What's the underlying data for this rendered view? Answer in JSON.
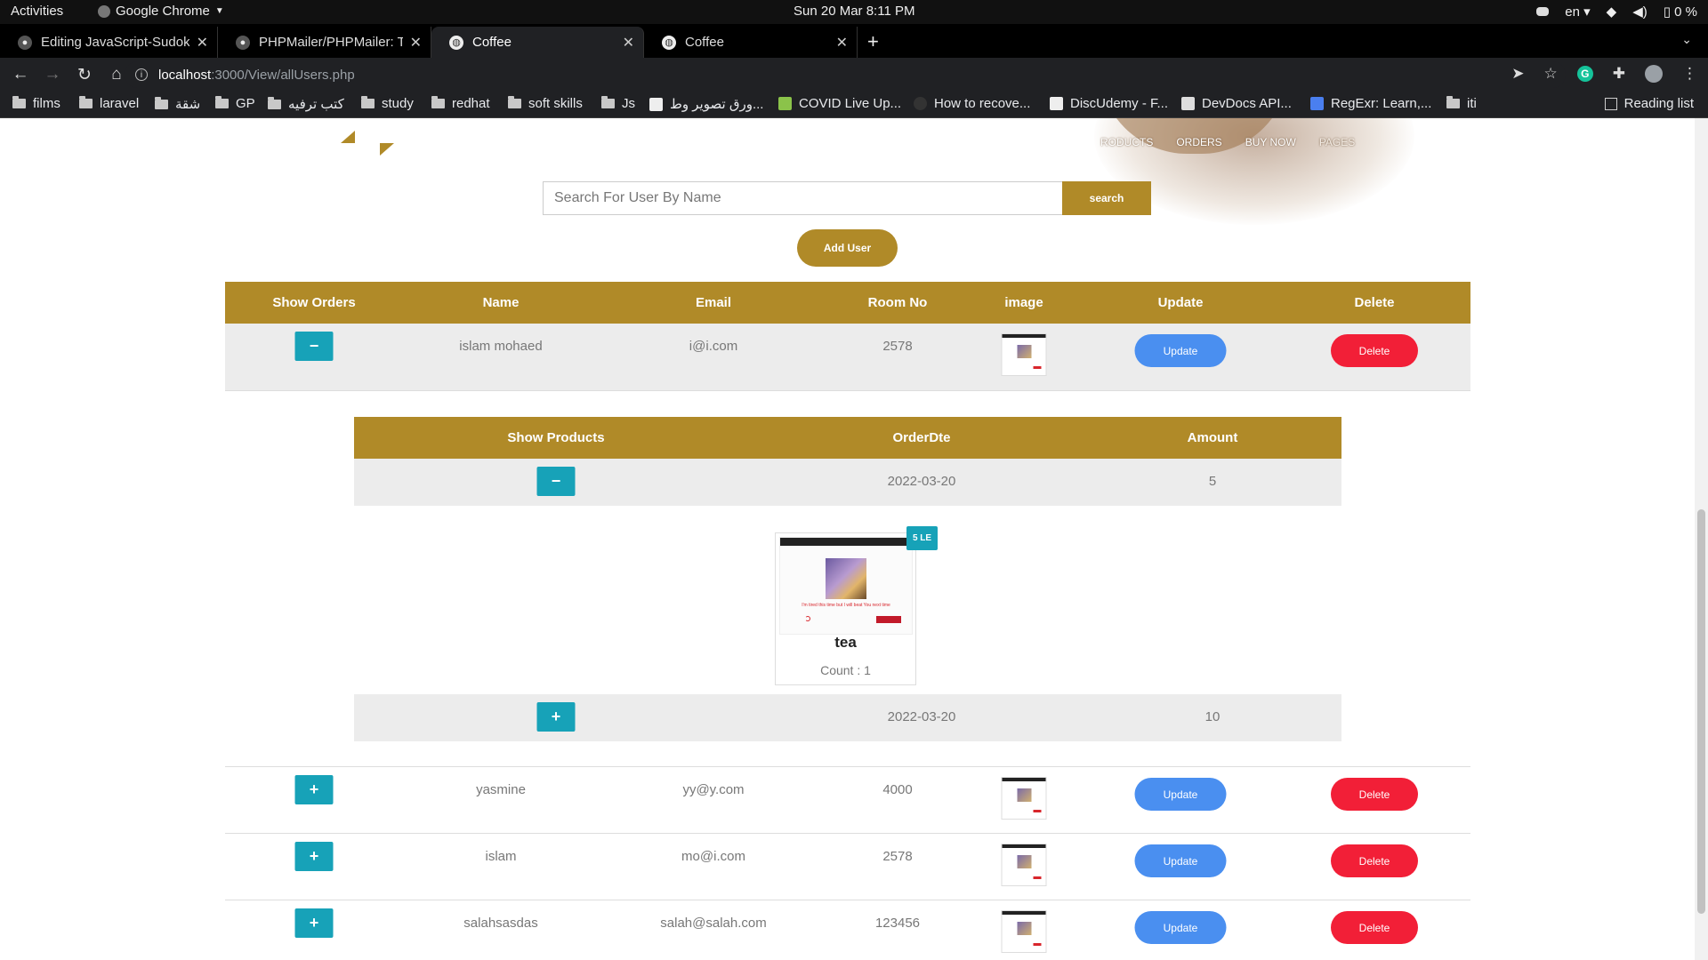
{
  "os_bar": {
    "activities": "Activities",
    "app_name": "Google Chrome",
    "clock": "Sun 20 Mar   8:11 PM",
    "lang": "en",
    "battery": "0 %"
  },
  "tabs": [
    {
      "title": "Editing JavaScript-Sudoku",
      "active": false
    },
    {
      "title": "PHPMailer/PHPMailer: Th",
      "active": false
    },
    {
      "title": "Coffee",
      "active": true
    },
    {
      "title": "Coffee",
      "active": false
    }
  ],
  "address_bar": {
    "host": "localhost",
    "path": ":3000/View/allUsers.php"
  },
  "bookmarks": [
    {
      "label": "films",
      "type": "folder"
    },
    {
      "label": "laravel",
      "type": "folder"
    },
    {
      "label": "شقة",
      "type": "folder"
    },
    {
      "label": "GP",
      "type": "folder"
    },
    {
      "label": "كتب ترفيه",
      "type": "folder"
    },
    {
      "label": "study",
      "type": "folder"
    },
    {
      "label": "redhat",
      "type": "folder"
    },
    {
      "label": "soft skills",
      "type": "folder"
    },
    {
      "label": "Js",
      "type": "folder"
    },
    {
      "label": "ورق تصوير وط...",
      "type": "link"
    },
    {
      "label": "COVID Live Up...",
      "type": "link"
    },
    {
      "label": "How to recove...",
      "type": "link"
    },
    {
      "label": "DiscUdemy - F...",
      "type": "link"
    },
    {
      "label": "DevDocs API...",
      "type": "link"
    },
    {
      "label": "RegExr: Learn,...",
      "type": "link"
    },
    {
      "label": "iti",
      "type": "folder"
    }
  ],
  "reading_list": "Reading list",
  "site_nav": [
    "RODUCTS",
    "ORDERS",
    "BUY NOW",
    "PAGES"
  ],
  "search": {
    "placeholder": "Search For User By Name",
    "button": "search"
  },
  "add_user_button": "Add User",
  "users_table": {
    "headers": [
      "Show Orders",
      "Name",
      "Email",
      "Room No",
      "image",
      "Update",
      "Delete"
    ],
    "update_label": "Update",
    "delete_label": "Delete",
    "rows": [
      {
        "toggle": "−",
        "name": "islam mohaed",
        "email": "i@i.com",
        "room": "2578"
      },
      {
        "toggle": "+",
        "name": "yasmine",
        "email": "yy@y.com",
        "room": "4000"
      },
      {
        "toggle": "+",
        "name": "islam",
        "email": "mo@i.com",
        "room": "2578"
      },
      {
        "toggle": "+",
        "name": "salahsasdas",
        "email": "salah@salah.com",
        "room": "123456"
      }
    ]
  },
  "orders_table": {
    "headers": [
      "Show Products",
      "OrderDte",
      "Amount"
    ],
    "rows": [
      {
        "toggle": "−",
        "date": "2022-03-20",
        "amount": "5"
      },
      {
        "toggle": "+",
        "date": "2022-03-20",
        "amount": "10"
      }
    ]
  },
  "product_card": {
    "name": "tea",
    "count": "Count : 1",
    "price": "5 LE",
    "image_caption": "I'm tired this time but I will beat You next time"
  },
  "colors": {
    "gold": "#b08a28",
    "teal": "#17a2b8",
    "update_blue": "#4a8ff0",
    "delete_red": "#f21f37"
  }
}
